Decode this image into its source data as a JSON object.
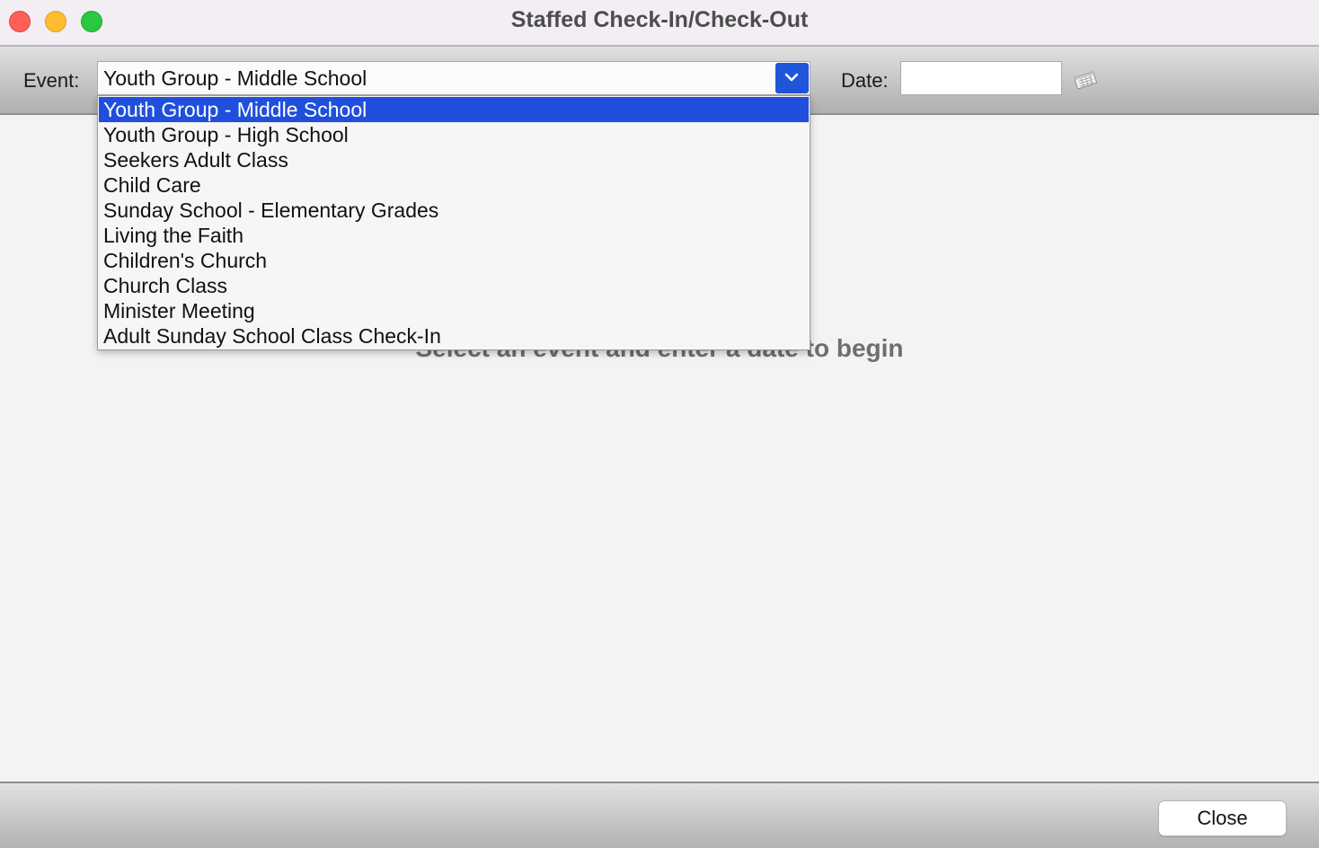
{
  "window": {
    "title": "Staffed Check-In/Check-Out"
  },
  "toolbar": {
    "event_label": "Event:",
    "event_selected": "Youth Group - Middle School",
    "date_label": "Date:",
    "date_value": ""
  },
  "dropdown": {
    "items": [
      {
        "label": "Youth Group - Middle School",
        "selected": true
      },
      {
        "label": "Youth Group - High School",
        "selected": false
      },
      {
        "label": "Seekers Adult Class",
        "selected": false
      },
      {
        "label": "Child Care",
        "selected": false
      },
      {
        "label": "Sunday School - Elementary Grades",
        "selected": false
      },
      {
        "label": "Living the Faith",
        "selected": false
      },
      {
        "label": "Children's Church",
        "selected": false
      },
      {
        "label": "Church Class",
        "selected": false
      },
      {
        "label": "Minister Meeting",
        "selected": false
      },
      {
        "label": "Adult Sunday School Class Check-In",
        "selected": false
      }
    ]
  },
  "main": {
    "hint": "Select an event and enter a date to begin"
  },
  "footer": {
    "close_label": "Close"
  },
  "icons": {
    "window_close": "close-icon",
    "window_minimize": "minimize-icon",
    "window_zoom": "zoom-icon",
    "dropdown_arrow": "chevron-down-icon",
    "date_picker": "calendar-icon"
  },
  "colors": {
    "selection": "#1f4fdc",
    "dropdown_button": "#1f55d8",
    "traffic_red": "#fe5f57",
    "traffic_yellow": "#febc2e",
    "traffic_green": "#28c840"
  }
}
